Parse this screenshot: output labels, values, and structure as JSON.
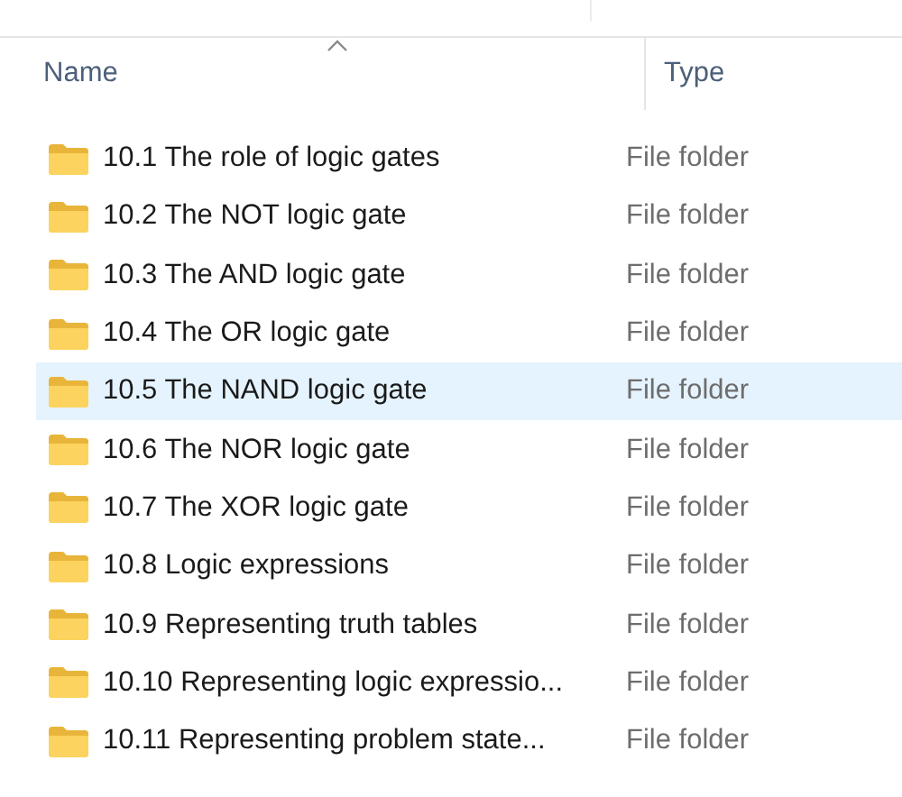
{
  "columns": [
    {
      "label": "Name",
      "sorted": true
    },
    {
      "label": "Type",
      "sorted": false
    }
  ],
  "rows": [
    {
      "name": "10.1 The role of logic gates",
      "type": "File folder",
      "selected": false
    },
    {
      "name": "10.2 The NOT logic gate",
      "type": "File folder",
      "selected": false
    },
    {
      "name": "10.3 The AND logic gate",
      "type": "File folder",
      "selected": false
    },
    {
      "name": "10.4 The OR logic gate",
      "type": "File folder",
      "selected": false
    },
    {
      "name": "10.5 The NAND logic gate",
      "type": "File folder",
      "selected": true
    },
    {
      "name": "10.6 The NOR logic gate",
      "type": "File folder",
      "selected": false
    },
    {
      "name": "10.7 The XOR logic gate",
      "type": "File folder",
      "selected": false
    },
    {
      "name": "10.8 Logic expressions",
      "type": "File folder",
      "selected": false
    },
    {
      "name": "10.9 Representing truth tables",
      "type": "File folder",
      "selected": false
    },
    {
      "name": "10.10 Representing logic expressio...",
      "type": "File folder",
      "selected": false
    },
    {
      "name": "10.11 Representing problem state...",
      "type": "File folder",
      "selected": false
    }
  ]
}
